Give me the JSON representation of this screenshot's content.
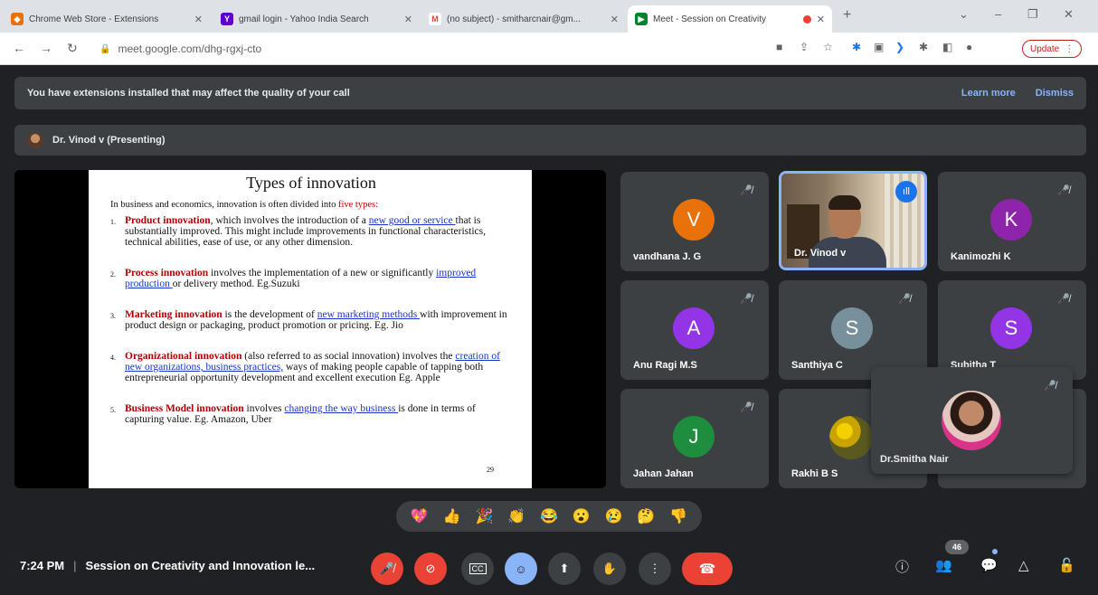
{
  "browser": {
    "tabs": [
      {
        "label": "Chrome Web Store - Extensions",
        "icon": "chrome-web-store-icon",
        "color": "#e8710a"
      },
      {
        "label": "gmail login - Yahoo India Search",
        "icon": "yahoo-icon",
        "color": "#6001d2"
      },
      {
        "label": "(no subject) - smitharcnair@gm...",
        "icon": "gmail-icon",
        "color": "#ea4335"
      },
      {
        "label": "Meet - Session on Creativity",
        "icon": "meet-icon",
        "color": "#00832d"
      }
    ],
    "url": "meet.google.com/dhg-rgxj-cto",
    "update_label": "Update"
  },
  "banner": {
    "message": "You have extensions installed that may affect the quality of your call",
    "learn_more": "Learn more",
    "dismiss": "Dismiss"
  },
  "presenter": {
    "label": "Dr. Vinod v (Presenting)"
  },
  "slide": {
    "title": "Types of innovation",
    "intro_prefix": "In business and economics, innovation is often divided into ",
    "intro_highlight": "five types:",
    "items": [
      {
        "num": "1.",
        "head": "Product innovation",
        "pre": ", which involves the introduction of a ",
        "link": "new good or service ",
        "post": "that is substantially improved. This might include improvements in functional characteristics, technical abilities, ease of use, or any other dimension."
      },
      {
        "num": "2.",
        "head": "Process innovation",
        "pre": " involves the implementation of a new or significantly ",
        "link": "improved production ",
        "post": "or delivery method. Eg.Suzuki"
      },
      {
        "num": "3.",
        "head": "Marketing innovation",
        "pre": " is the development of ",
        "link": "new marketing methods ",
        "post": "with improvement in product design or packaging, product promotion or pricing. Eg. Jio"
      },
      {
        "num": "4.",
        "head": "Organizational innovation",
        "pre": " (also referred to as social innovation) involves the ",
        "link": "creation of new organizations, business practices,",
        "post": " ways of making people capable of tapping both entrepreneurial opportunity development and excellent execution Eg. Apple"
      },
      {
        "num": "5.",
        "head": "Business Model innovation",
        "pre": " involves ",
        "link": "changing the way business ",
        "post": "is done in terms of capturing value. Eg. Amazon, Uber"
      }
    ],
    "page": "29"
  },
  "participants": [
    {
      "name": "vandhana J. G",
      "initial": "V",
      "color": "#e8710a"
    },
    {
      "name": "Dr. Vinod v",
      "initial": "",
      "color": ""
    },
    {
      "name": "Kanimozhi K",
      "initial": "K",
      "color": "#8e24aa"
    },
    {
      "name": "Anu Ragi M.S",
      "initial": "A",
      "color": "#9334e6"
    },
    {
      "name": "Santhiya C",
      "initial": "S",
      "color": "#78909c"
    },
    {
      "name": "Subitha T",
      "initial": "S",
      "color": "#9334e6"
    },
    {
      "name": "Jahan Jahan",
      "initial": "J",
      "color": "#1e8e3e"
    },
    {
      "name": "Rakhi B S",
      "initial": "",
      "color": ""
    }
  ],
  "self_view": {
    "name": "Dr.Smitha Nair"
  },
  "reactions": [
    "💖",
    "👍",
    "🎉",
    "👏",
    "😂",
    "😮",
    "😢",
    "🤔",
    "👎"
  ],
  "bottom": {
    "time": "7:24 PM",
    "meeting_title": "Session on Creativity and Innovation le...",
    "participant_count": "46"
  }
}
